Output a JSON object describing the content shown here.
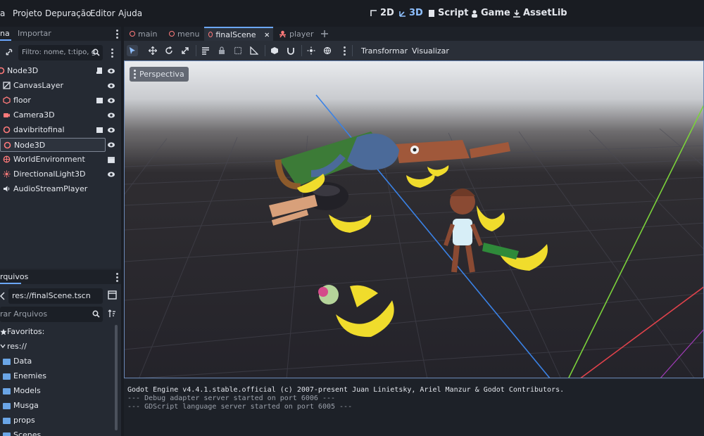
{
  "menubar": {
    "items": [
      "a",
      "Projeto",
      "Depuração",
      "Editor",
      "Ajuda"
    ],
    "workspaces": [
      "2D",
      "3D",
      "Script",
      "Game",
      "AssetLib"
    ],
    "active_workspace": "3D"
  },
  "scene_dock": {
    "tabs": [
      "na",
      "Importar"
    ],
    "filter_placeholder": "Filtro: nome, t:tipo, g",
    "nodes": [
      {
        "label": "Node3D",
        "icon": "node3d-icon",
        "has_script": true,
        "visible": true
      },
      {
        "label": "CanvasLayer",
        "icon": "canvaslayer-icon",
        "has_script": false,
        "visible": true
      },
      {
        "label": "floor",
        "icon": "mesh-icon",
        "has_script": false,
        "has_clapper": true,
        "visible": true
      },
      {
        "label": "Camera3D",
        "icon": "camera-icon",
        "has_script": false,
        "visible": true
      },
      {
        "label": "davibritofinal",
        "icon": "node3d-icon",
        "has_clapper": true,
        "visible": true
      },
      {
        "label": "Node3D",
        "icon": "node3d-icon",
        "selected": true,
        "visible": true
      },
      {
        "label": "WorldEnvironment",
        "icon": "world-icon",
        "has_clapper": true
      },
      {
        "label": "DirectionalLight3D",
        "icon": "light-icon",
        "visible": true
      },
      {
        "label": "AudioStreamPlayer",
        "icon": "audio-icon"
      }
    ]
  },
  "filesystem": {
    "tab": "rquivos",
    "path": "res://finalScene.tscn",
    "search_placeholder": "rar Arquivos",
    "items": [
      {
        "label": "Favoritos:",
        "type": "star"
      },
      {
        "label": "res://",
        "type": "folder"
      },
      {
        "label": "Data",
        "type": "folder"
      },
      {
        "label": "Enemies",
        "type": "folder"
      },
      {
        "label": "Models",
        "type": "folder"
      },
      {
        "label": "Musga",
        "type": "folder"
      },
      {
        "label": "props",
        "type": "folder"
      },
      {
        "label": "Scenes",
        "type": "folder"
      }
    ]
  },
  "scene_tabs": [
    {
      "label": "main",
      "active": false
    },
    {
      "label": "menu",
      "active": false
    },
    {
      "label": "finalScene",
      "active": true
    },
    {
      "label": "player",
      "active": false
    }
  ],
  "toolbar": {
    "transform_label": "Transformar",
    "view_label": "Visualizar"
  },
  "viewport": {
    "perspective_label": "Perspectiva"
  },
  "output": {
    "lines": [
      "Godot Engine v4.4.1.stable.official (c) 2007-present Juan Linietsky, Ariel Manzur & Godot Contributors.",
      "--- Debug adapter server started on port 6006 ---",
      "--- GDScript language server started on port 6005 ---"
    ]
  },
  "colors": {
    "accent": "#6ba7ff",
    "axis_x": "#e0424b",
    "axis_y": "#7bd23b",
    "axis_z": "#3a82e6"
  }
}
